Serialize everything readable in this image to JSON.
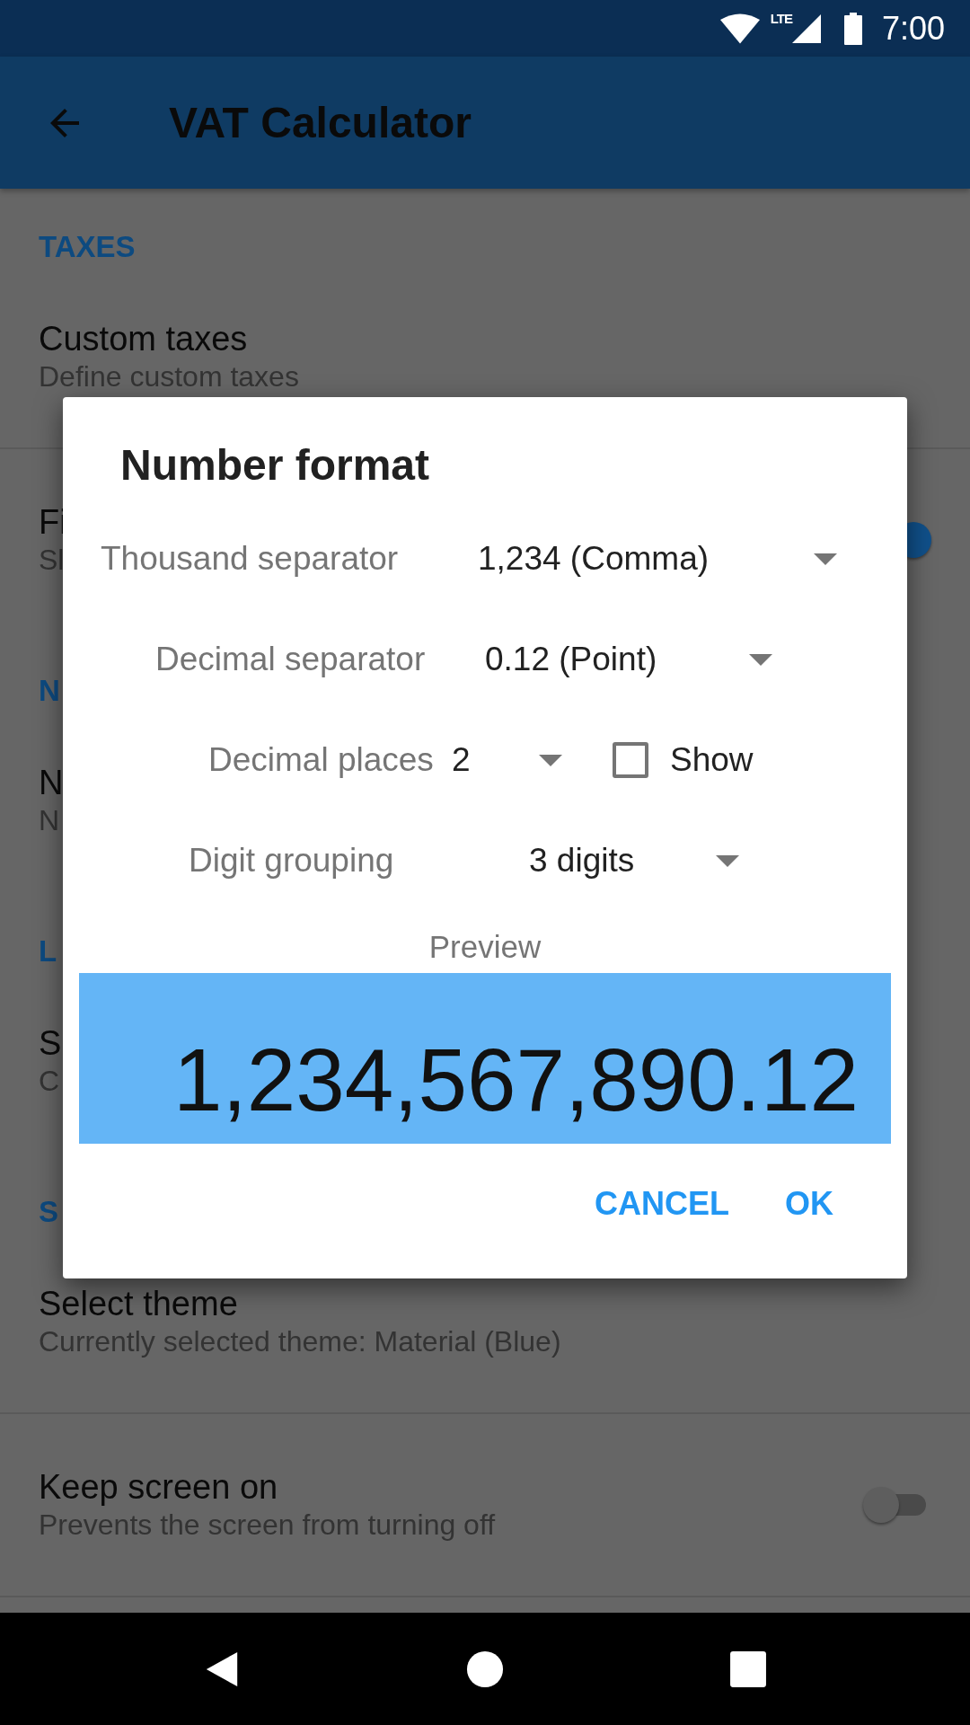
{
  "status_bar": {
    "time": "7:00",
    "network": "LTE"
  },
  "app_bar": {
    "title": "VAT Calculator"
  },
  "settings": [
    {
      "kind": "header",
      "title": "TAXES"
    },
    {
      "kind": "item",
      "title": "Custom taxes",
      "subtitle": "Define custom taxes"
    },
    {
      "kind": "switch",
      "title": "Fi",
      "subtitle": "Sl",
      "on": true
    },
    {
      "kind": "header",
      "title": "N"
    },
    {
      "kind": "item",
      "title": "N",
      "subtitle": "N"
    },
    {
      "kind": "header",
      "title": "L"
    },
    {
      "kind": "item",
      "title": "S",
      "subtitle": "C"
    },
    {
      "kind": "header",
      "title": "S"
    },
    {
      "kind": "item",
      "title": "Select theme",
      "subtitle": "Currently selected theme: Material (Blue)"
    },
    {
      "kind": "switch",
      "title": "Keep screen on",
      "subtitle": "Prevents the screen from turning off",
      "on": false
    }
  ],
  "dialog": {
    "title": "Number format",
    "rows": [
      {
        "label": "Thousand separator",
        "value": "1,234 (Comma)"
      },
      {
        "label": "Decimal separator",
        "value": "0.12 (Point)"
      },
      {
        "label": "Decimal places",
        "value": "2",
        "checkbox": {
          "label": "Show",
          "checked": false
        }
      },
      {
        "label": "Digit grouping",
        "value": "3 digits"
      }
    ],
    "preview_label": "Preview",
    "preview": "1,234,567,890.12",
    "buttons": [
      "CANCEL",
      "OK"
    ]
  }
}
